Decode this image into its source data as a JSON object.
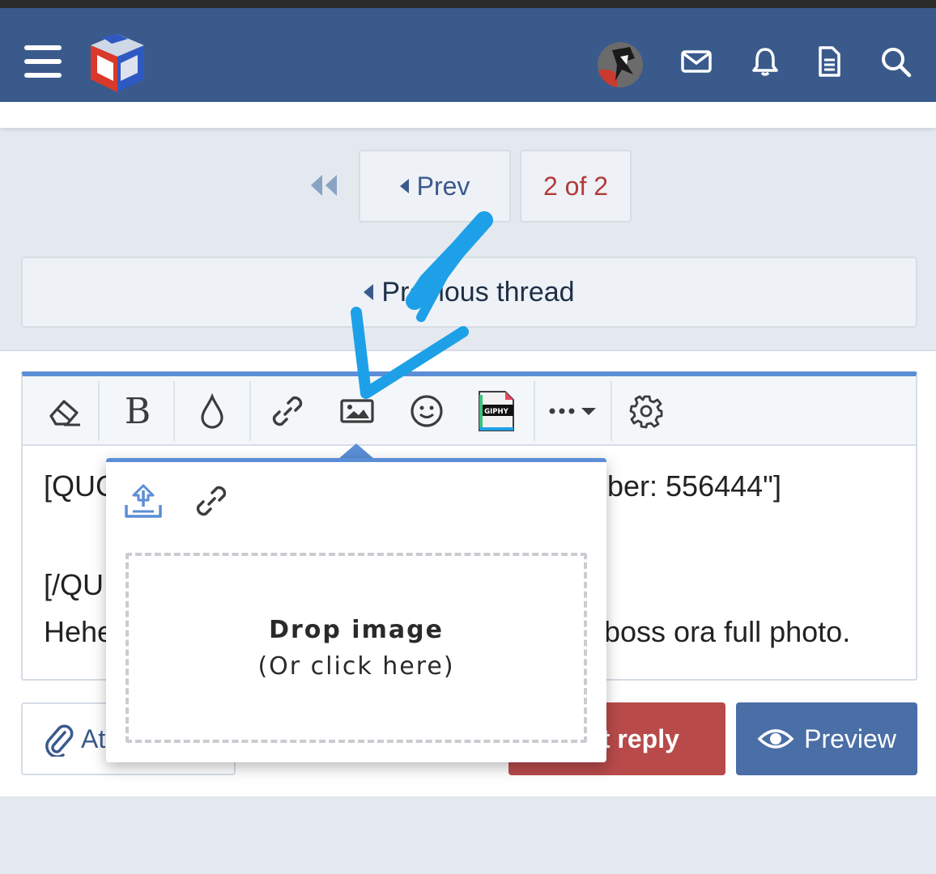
{
  "header": {
    "menu_icon": "hamburger-menu-icon",
    "logo": "site-logo-cube",
    "icons": [
      "avatar",
      "mail-icon",
      "bell-icon",
      "document-icon",
      "search-icon"
    ],
    "colors": {
      "header_bg": "#3a5a8c",
      "accent": "#5b8ed6",
      "post_button": "#b84a4a",
      "preview_button": "#4a6ea6",
      "current_page": "#b23a3a"
    }
  },
  "pagination": {
    "prev_label": "Prev",
    "current_label": "2 of 2"
  },
  "previous_thread": {
    "label": "Previous thread"
  },
  "editor": {
    "toolbar": {
      "bold_label": "B",
      "giphy_label": "GIPHY",
      "items": [
        "eraser-icon",
        "bold-icon",
        "color-drop-icon",
        "link-icon",
        "image-icon",
        "smiley-icon",
        "giphy-icon",
        "more-icon",
        "gear-icon"
      ]
    },
    "lines": {
      "line1_left": "[QUC",
      "line1_right": "ber: 556444\"]",
      "line2_left": "[/QU",
      "line3_left": "Hehe",
      "line3_right": "boss ora full photo."
    }
  },
  "image_popup": {
    "tabs": [
      "upload-icon",
      "link-icon"
    ],
    "drop_title": "Drop image",
    "drop_subtitle": "(Or click here)"
  },
  "buttons": {
    "attach_label": "At",
    "post_label": "st reply",
    "preview_label": "Preview"
  },
  "annotation": {
    "color": "#1ea0e8"
  }
}
